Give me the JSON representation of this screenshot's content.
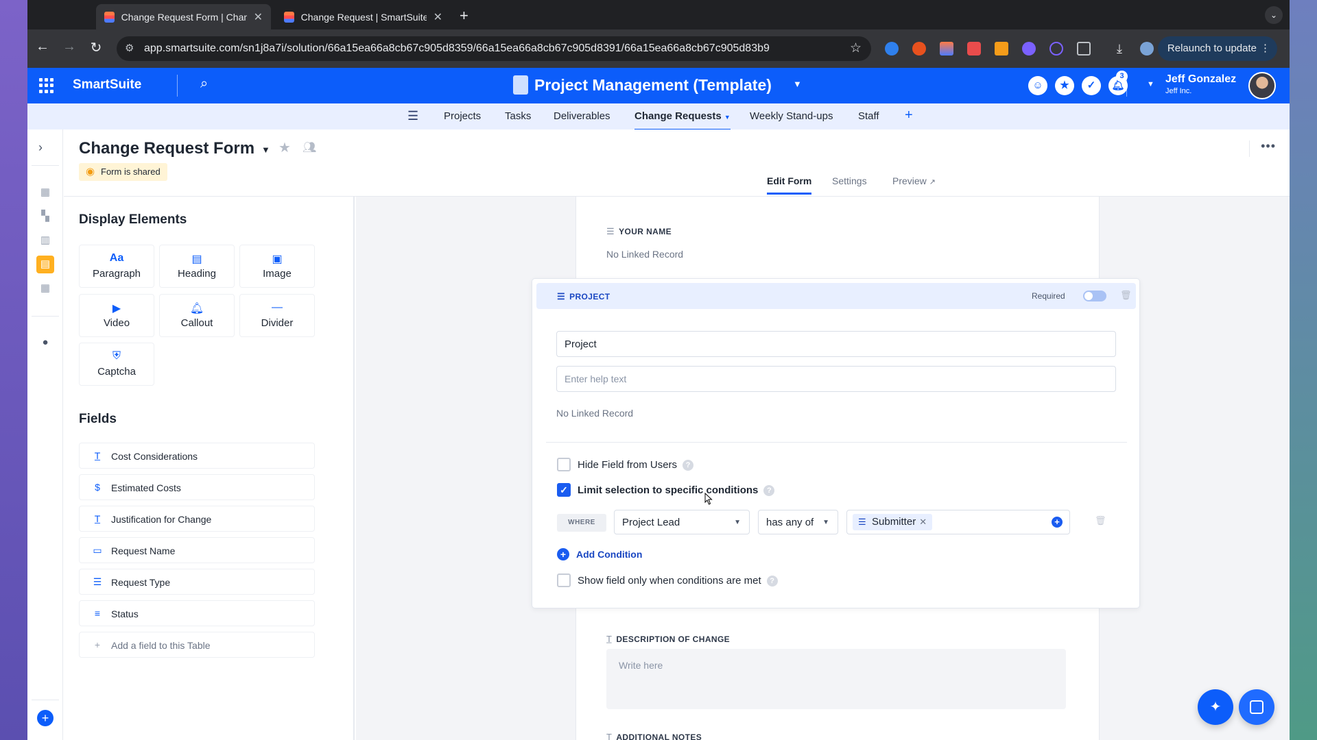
{
  "browser": {
    "tabs": [
      {
        "title": "Change Request Form | Change Requests",
        "active": true
      },
      {
        "title": "Change Request | SmartSuite",
        "active": false
      }
    ],
    "url": "app.smartsuite.com/sn1j8a7i/solution/66a15ea66a8cb67c905d8359/66a15ea66a8cb67c905d8391/66a15ea66a8cb67c905d83b9",
    "relaunch_label": "Relaunch to update"
  },
  "app": {
    "brand": "SmartSuite",
    "solution_title": "Project Management (Template)",
    "notification_count": "3",
    "user": {
      "name": "Jeff Gonzalez",
      "org": "Jeff Inc."
    },
    "accent_color": "#0c5dfa"
  },
  "nav": {
    "tabs": [
      {
        "label": "Projects"
      },
      {
        "label": "Tasks"
      },
      {
        "label": "Deliverables"
      },
      {
        "label": "Change Requests",
        "active": true
      },
      {
        "label": "Weekly Stand-ups"
      },
      {
        "label": "Staff"
      }
    ]
  },
  "page": {
    "title": "Change Request Form",
    "shared_badge": "Form is shared",
    "subtabs": [
      {
        "label": "Edit Form",
        "active": true
      },
      {
        "label": "Settings"
      },
      {
        "label": "Preview"
      }
    ]
  },
  "display_elements": {
    "heading": "Display Elements",
    "items": [
      {
        "label": "Paragraph",
        "icon": "paragraph-icon"
      },
      {
        "label": "Heading",
        "icon": "heading-icon"
      },
      {
        "label": "Image",
        "icon": "image-icon"
      },
      {
        "label": "Video",
        "icon": "video-icon"
      },
      {
        "label": "Callout",
        "icon": "bell-icon"
      },
      {
        "label": "Divider",
        "icon": "divider-icon"
      },
      {
        "label": "Captcha",
        "icon": "shield-icon"
      }
    ]
  },
  "fields": {
    "heading": "Fields",
    "items": [
      {
        "label": "Cost Considerations",
        "icon": "text-icon"
      },
      {
        "label": "Estimated Costs",
        "icon": "dollar-icon"
      },
      {
        "label": "Justification for Change",
        "icon": "text-icon"
      },
      {
        "label": "Request Name",
        "icon": "record-title-icon"
      },
      {
        "label": "Request Type",
        "icon": "list-icon"
      },
      {
        "label": "Status",
        "icon": "status-icon"
      }
    ],
    "add_label": "Add a field to this Table"
  },
  "form": {
    "your_name": {
      "label": "YOUR NAME",
      "value": "No Linked Record"
    },
    "project": {
      "header": "PROJECT",
      "required_label": "Required",
      "required": false,
      "label_value": "Project",
      "help_placeholder": "Enter help text",
      "linked_text": "No Linked Record",
      "hide_field_label": "Hide Field from Users",
      "hide_field_checked": false,
      "limit_label": "Limit selection to specific conditions",
      "limit_checked": true,
      "condition": {
        "where": "WHERE",
        "field": "Project Lead",
        "operator": "has any of",
        "value": "Submitter"
      },
      "add_condition_label": "Add Condition",
      "show_field_label": "Show field only when conditions are met",
      "show_field_checked": false
    },
    "description": {
      "label": "DESCRIPTION OF CHANGE",
      "placeholder": "Write here"
    },
    "additional_notes": {
      "label": "ADDITIONAL NOTES"
    }
  }
}
